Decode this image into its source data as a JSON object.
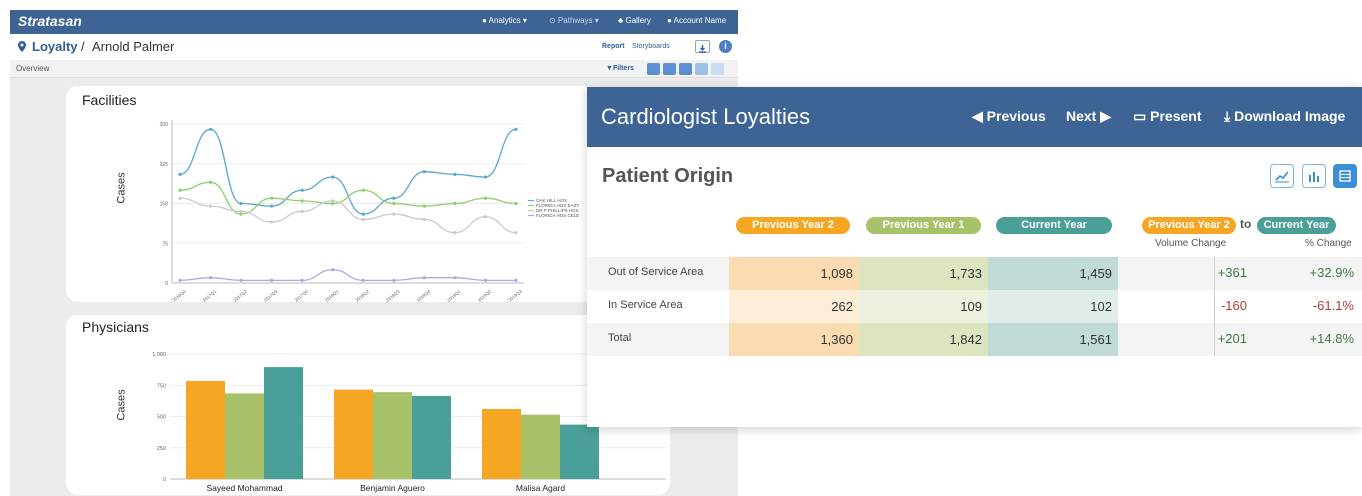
{
  "app": {
    "brand": "Stratasan",
    "nav": {
      "analytics": "Analytics",
      "pathways": "Pathways",
      "gallery": "Gallery",
      "account": "Account Name"
    },
    "breadcrumb": {
      "root": "Loyalty",
      "separator": "/",
      "leaf": "Arnold Palmer"
    },
    "links": {
      "report": "Report",
      "storyboards": "Storyboards"
    },
    "subbar": {
      "overview": "Overview",
      "filters": "Filters"
    },
    "facilities": {
      "title": "Facilities",
      "ylabel": "Cases",
      "yticks": [
        "300",
        "225",
        "150",
        "75",
        "0"
      ],
      "xticks": [
        "2016Q4",
        "2017Q1",
        "2017Q2",
        "2017Q3",
        "2017Q4",
        "2018Q1",
        "2018Q2",
        "2018Q3",
        "2018Q4",
        "2019Q1",
        "2019Q2",
        "2019Q3"
      ],
      "legend": [
        "OAK HILL HOS",
        "FLORIDA HOS EAST",
        "DR P PHILLIPS HOS",
        "FLORIDA HOS CELE"
      ]
    },
    "physicians": {
      "title": "Physicians",
      "ylabel": "Cases",
      "yticks": [
        "1,000",
        "750",
        "500",
        "250",
        "0"
      ],
      "categories": [
        "Sayeed Mohammad",
        "Benjamin Aguero",
        "Malisa Agard"
      ]
    }
  },
  "front": {
    "title": "Cardiologist Loyalties",
    "previous": "◀ Previous",
    "next": "Next ▶",
    "present": "Present",
    "download": "Download Image",
    "section": "Patient Origin",
    "headers": {
      "py2": "Previous Year 2",
      "py1": "Previous Year 1",
      "cy": "Current Year",
      "from": "Previous Year 2",
      "to": "to",
      "dest": "Current Year"
    },
    "subheaders": {
      "volume": "Volume Change",
      "pct": "% Change"
    },
    "rows": [
      {
        "label": "Out of Service Area",
        "py2": "1,098",
        "py1": "1,733",
        "cy": "1,459",
        "vol": "+361",
        "pct": "+32.9%"
      },
      {
        "label": "In Service Area",
        "py2": "262",
        "py1": "109",
        "cy": "102",
        "vol": "-160",
        "pct": "-61.1%"
      },
      {
        "label": "Total",
        "py2": "1,360",
        "py1": "1,842",
        "cy": "1,561",
        "vol": "+201",
        "pct": "+14.8%"
      }
    ]
  },
  "colors": {
    "header": "#3d6494",
    "py2": "#f5a623",
    "py1": "#a8c26a",
    "cy": "#4a9f98",
    "positive": "#3e7a3e",
    "negative": "#b23b3b"
  },
  "chart_data": [
    {
      "type": "line",
      "title": "Facilities",
      "ylabel": "Cases",
      "ylim": [
        0,
        300
      ],
      "x": [
        "2016Q4",
        "2017Q1",
        "2017Q2",
        "2017Q3",
        "2017Q4",
        "2018Q1",
        "2018Q2",
        "2018Q3",
        "2018Q4",
        "2019Q1",
        "2019Q2",
        "2019Q3"
      ],
      "series": [
        {
          "name": "OAK HILL HOS",
          "color": "#5aa8c8",
          "values": [
            205,
            290,
            150,
            145,
            175,
            200,
            130,
            160,
            210,
            205,
            200,
            290
          ]
        },
        {
          "name": "FLORIDA HOS EAST",
          "color": "#8fcf6a",
          "values": [
            175,
            190,
            130,
            160,
            155,
            150,
            175,
            150,
            145,
            150,
            160,
            150
          ]
        },
        {
          "name": "DR P PHILLIPS HOS",
          "color": "#c9c9c9",
          "values": [
            160,
            145,
            135,
            115,
            135,
            155,
            120,
            130,
            120,
            95,
            125,
            95
          ]
        },
        {
          "name": "FLORIDA HOS CELE",
          "color": "#a9a7e8",
          "values": [
            5,
            10,
            5,
            5,
            5,
            25,
            5,
            5,
            10,
            10,
            5,
            5
          ]
        }
      ]
    },
    {
      "type": "bar",
      "title": "Physicians",
      "ylabel": "Cases",
      "ylim": [
        0,
        1000
      ],
      "categories": [
        "Sayeed Mohammad",
        "Benjamin Aguero",
        "Malisa Agard"
      ],
      "series": [
        {
          "color": "#f5a623",
          "values": [
            785,
            715,
            560
          ]
        },
        {
          "color": "#a8c26a",
          "values": [
            685,
            695,
            515
          ]
        },
        {
          "color": "#4a9f98",
          "values": [
            895,
            665,
            435
          ]
        }
      ]
    }
  ]
}
